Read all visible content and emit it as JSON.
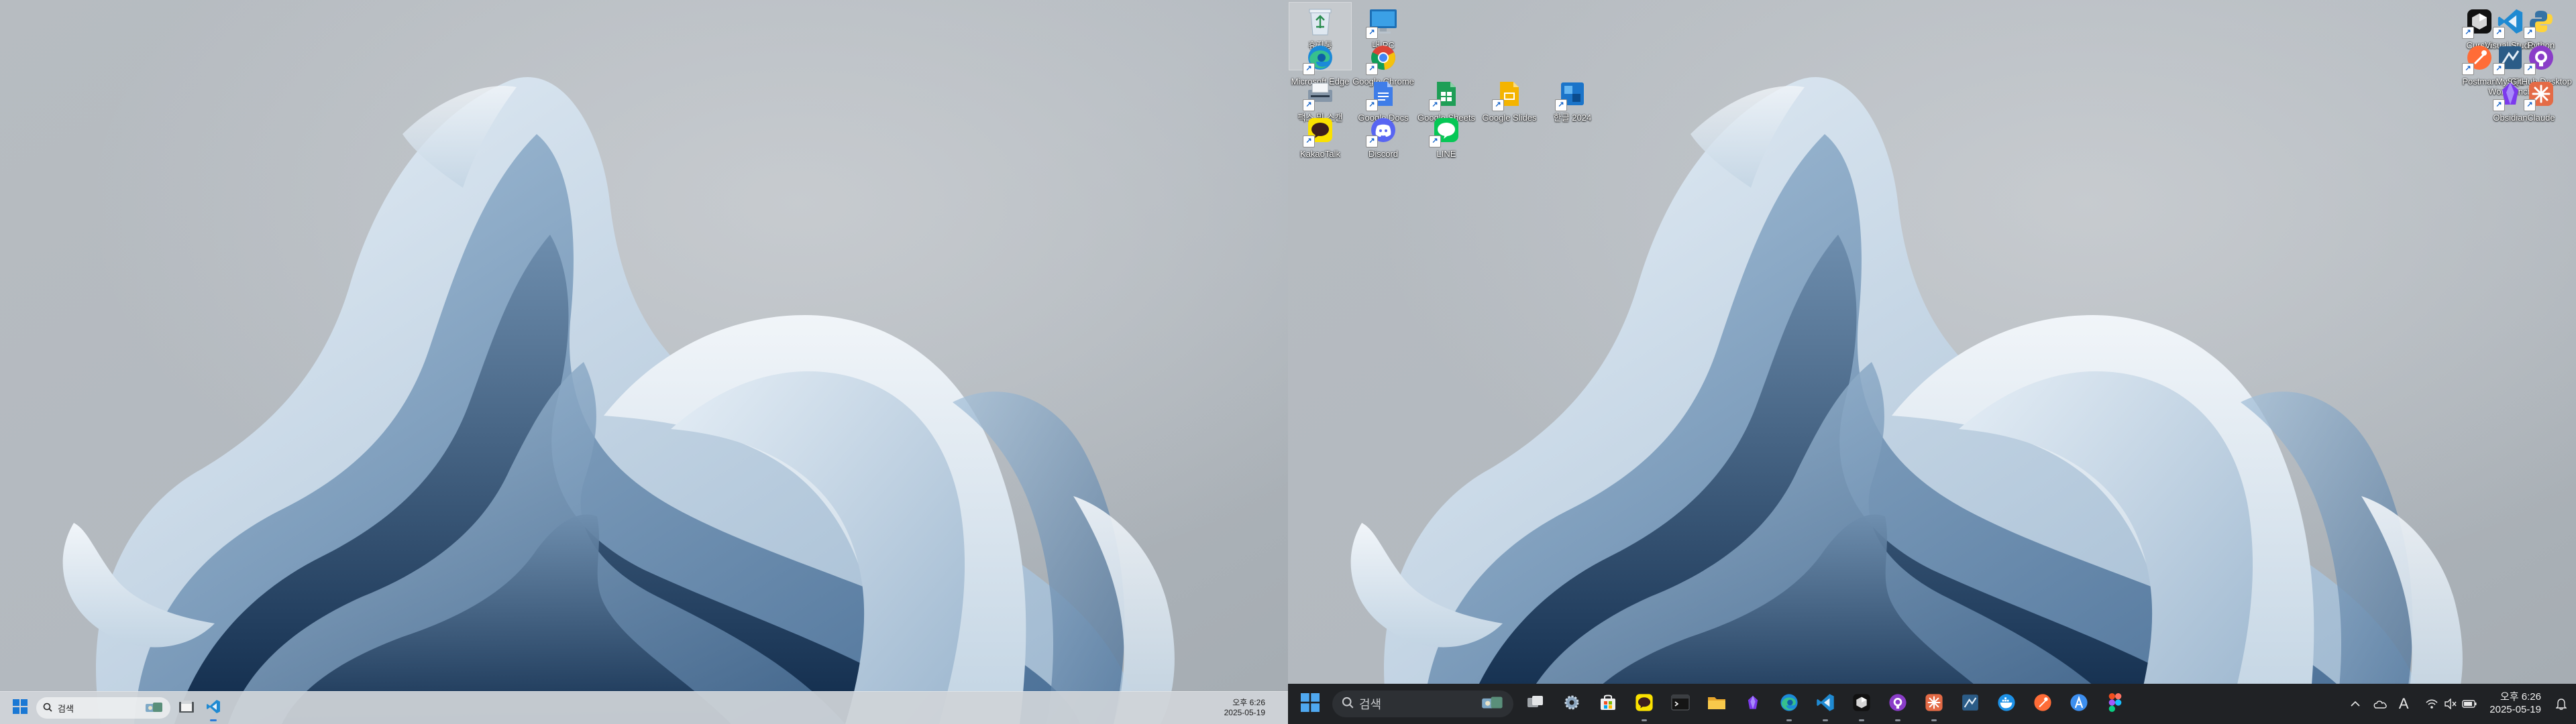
{
  "left_monitor": {
    "taskbar": {
      "search_placeholder": "검색",
      "clock_time": "오후 6:26",
      "clock_date": "2025-05-19",
      "pinned_apps": [
        {
          "name": "file-explorer",
          "running": false
        },
        {
          "name": "visual-studio-code",
          "running": true
        }
      ]
    }
  },
  "right_monitor": {
    "desktop_icons": [
      {
        "id": "recycle-bin",
        "label": "휴지통",
        "icon": "recycle-bin-icon"
      },
      {
        "id": "this-pc",
        "label": "내 PC",
        "icon": "this-pc-icon"
      },
      {
        "id": "microsoft-edge",
        "label": "Microsoft Edge",
        "icon": "edge-icon"
      },
      {
        "id": "google-chrome",
        "label": "Google Chrome",
        "icon": "chrome-icon"
      },
      {
        "id": "scanner",
        "label": "팩스 및 스캔",
        "icon": "scanner-icon"
      },
      {
        "id": "google-docs",
        "label": "Google Docs",
        "icon": "google-docs-icon"
      },
      {
        "id": "google-sheets",
        "label": "Google Sheets",
        "icon": "google-sheets-icon"
      },
      {
        "id": "google-slides",
        "label": "Google Slides",
        "icon": "google-slides-icon"
      },
      {
        "id": "hangul-2024",
        "label": "한글 2024",
        "icon": "hangul-icon"
      },
      {
        "id": "kakaotalk",
        "label": "KakaoTalk",
        "icon": "kakaotalk-icon"
      },
      {
        "id": "discord",
        "label": "Discord",
        "icon": "discord-icon"
      },
      {
        "id": "line",
        "label": "LINE",
        "icon": "line-icon"
      },
      {
        "id": "cursor",
        "label": "Cursor",
        "icon": "cursor-icon"
      },
      {
        "id": "visual-studio-code",
        "label": "Visual Studio Code",
        "icon": "vscode-icon"
      },
      {
        "id": "python",
        "label": "Python",
        "icon": "python-icon"
      },
      {
        "id": "postman",
        "label": "Postman",
        "icon": "postman-icon"
      },
      {
        "id": "mysql-workbench",
        "label": "MySQL Workbench",
        "icon": "mysql-workbench-icon"
      },
      {
        "id": "github-desktop",
        "label": "GitHub Desktop",
        "icon": "github-desktop-icon"
      },
      {
        "id": "obsidian",
        "label": "Obsidian",
        "icon": "obsidian-icon"
      },
      {
        "id": "claude",
        "label": "Claude",
        "icon": "claude-icon"
      }
    ],
    "taskbar": {
      "search_placeholder": "검색",
      "clock_time": "오후 6:26",
      "clock_date": "2025-05-19",
      "ime_indicator": "A",
      "pinned_apps": [
        {
          "name": "task-view",
          "running": false
        },
        {
          "name": "settings",
          "running": false
        },
        {
          "name": "microsoft-store",
          "running": false
        },
        {
          "name": "kakaotalk",
          "running": true
        },
        {
          "name": "terminal",
          "running": false
        },
        {
          "name": "file-explorer",
          "running": false
        },
        {
          "name": "obsidian",
          "running": false
        },
        {
          "name": "microsoft-edge",
          "running": true
        },
        {
          "name": "visual-studio-code",
          "running": true
        },
        {
          "name": "cursor",
          "running": true
        },
        {
          "name": "github-desktop",
          "running": true
        },
        {
          "name": "claude",
          "running": true
        },
        {
          "name": "mysql-workbench",
          "running": false
        },
        {
          "name": "docker",
          "running": false
        },
        {
          "name": "postman",
          "running": false
        },
        {
          "name": "app-store",
          "running": false
        },
        {
          "name": "figma",
          "running": false
        }
      ]
    }
  }
}
